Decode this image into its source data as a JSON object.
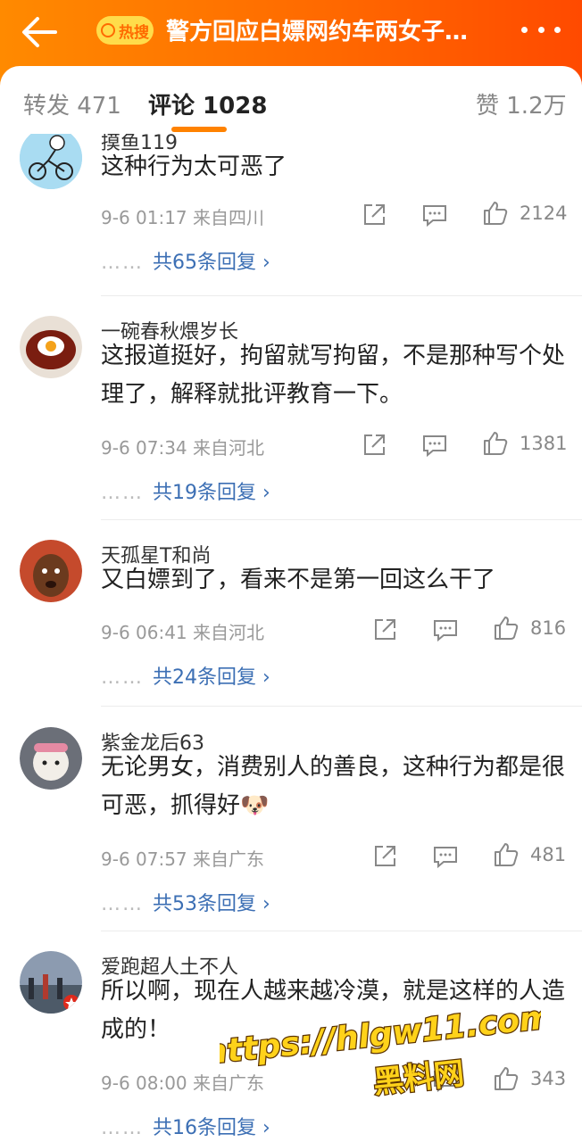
{
  "header": {
    "badge": "热搜",
    "title": "警方回应白嫖网约车两女子…"
  },
  "tabs": {
    "repost": "转发 471",
    "comments": "评论 1028",
    "likes": "赞 1.2万"
  },
  "comments": [
    {
      "user": "摸鱼119",
      "text": "这种行为太可恶了",
      "meta": "9-6 01:17  来自四川",
      "likes": "2124",
      "replies": "共65条回复 ›"
    },
    {
      "user": "一碗春秋煨岁长",
      "text": "这报道挺好，拘留就写拘留，不是那种写个处理了，解释就批评教育一下。",
      "meta": "9-6 07:34  来自河北",
      "likes": "1381",
      "replies": "共19条回复 ›"
    },
    {
      "user": "天孤星T和尚",
      "text": "又白嫖到了，看来不是第一回这么干了",
      "meta": "9-6 06:41  来自河北",
      "likes": "816",
      "replies": "共24条回复 ›"
    },
    {
      "user": "紫金龙后63",
      "text": "无论男女，消费别人的善良，这种行为都是很可恶，抓得好🐶",
      "meta": "9-6 07:57  来自广东",
      "likes": "481",
      "replies": "共53条回复 ›"
    },
    {
      "user": "爱跑超人土不人",
      "text": "所以啊，现在人越来越冷漠，就是这样的人造成的！",
      "meta": "9-6 08:00  来自广东",
      "likes": "343",
      "replies": "共16条回复 ›"
    }
  ],
  "reply_dots": "……",
  "watermark": {
    "line1": "https://hlgw11.com",
    "line2": "黑料网"
  },
  "colors": {
    "header_start": "#ff8a00",
    "header_end": "#ff4a00",
    "link": "#3c6fb4",
    "tab_indicator": "#ff8200"
  },
  "icons": [
    "back-arrow-icon",
    "search-icon",
    "more-dots-icon",
    "repost-icon",
    "comment-icon",
    "like-icon",
    "reply-chevron-icon"
  ]
}
